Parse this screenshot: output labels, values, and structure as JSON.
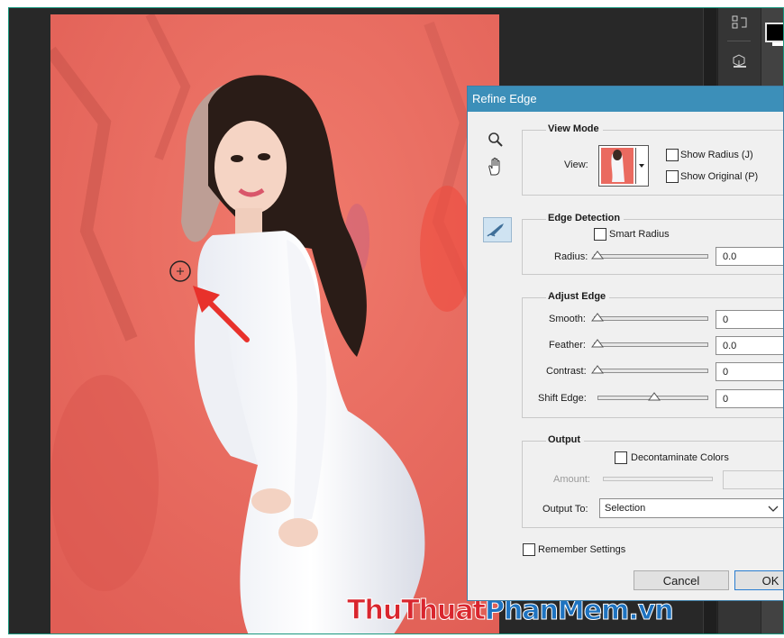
{
  "workspace": {
    "tool_icons": [
      "history-brush-icon",
      "transform-3d-icon"
    ]
  },
  "watermark": {
    "part1": "ThuThuat",
    "part2": "PhanMem",
    "part3": ".vn"
  },
  "dialog": {
    "title": "Refine Edge",
    "view_mode": {
      "heading": "View Mode",
      "view_label": "View:",
      "show_radius": "Show Radius (J)",
      "show_original": "Show Original (P)"
    },
    "edge_detection": {
      "heading": "Edge Detection",
      "smart_radius": "Smart Radius",
      "radius_label": "Radius:",
      "radius_value": "0.0"
    },
    "adjust_edge": {
      "heading": "Adjust Edge",
      "smooth_label": "Smooth:",
      "smooth_value": "0",
      "feather_label": "Feather:",
      "feather_value": "0.0",
      "contrast_label": "Contrast:",
      "contrast_value": "0",
      "shift_label": "Shift Edge:",
      "shift_value": "0"
    },
    "output": {
      "heading": "Output",
      "decontaminate": "Decontaminate Colors",
      "amount_label": "Amount:",
      "output_to_label": "Output To:",
      "output_to_value": "Selection"
    },
    "remember": "Remember Settings",
    "cancel": "Cancel",
    "ok": "OK"
  },
  "colors": {
    "selection_overlay": "#ea6a60",
    "dialog_title_bar": "#3c8fb9",
    "arrow": "#e8312b"
  }
}
